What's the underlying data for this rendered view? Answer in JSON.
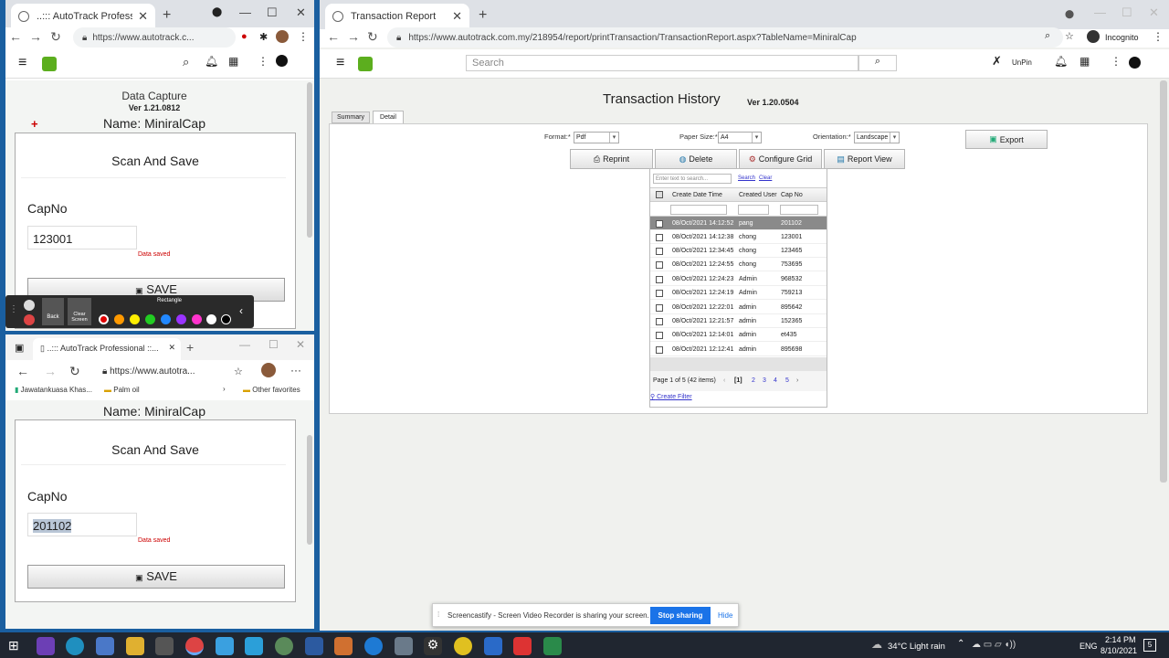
{
  "left_top_window": {
    "tab_title": "..::: AutoTrack Professional ::...",
    "url": "https://www.autotrack.c...",
    "app_title": "Data Capture",
    "version": "Ver 1.21.0812",
    "name_label": "Name: MiniralCap",
    "form_title": "Scan And Save",
    "field_label": "CapNo",
    "field_value": "123001",
    "status": "Data saved",
    "save_label": "SAVE"
  },
  "annotation_toolbar": {
    "back_label": "Back",
    "clear_label": "Clear Screen",
    "rect_label": "Rectangle",
    "colors": [
      "#e00000",
      "#ff9900",
      "#ffee00",
      "#22cc22",
      "#2288ff",
      "#9933ff",
      "#ff33cc",
      "#ffffff",
      "#000000"
    ]
  },
  "left_bottom_window": {
    "tab_title": "..::: AutoTrack Professional ::...",
    "url": "https://www.autotra...",
    "bookmark1": "Jawatankuasa Khas...",
    "bookmark2": "Palm oil",
    "bookmark3": "Other favorites",
    "name_label": "Name: MiniralCap",
    "form_title": "Scan And Save",
    "field_label": "CapNo",
    "field_value": "201102",
    "status": "Data saved",
    "save_label": "SAVE"
  },
  "main_window": {
    "tab_title": "Transaction Report",
    "url": "https://www.autotrack.com.my/218954/report/printTransaction/TransactionReport.aspx?TableName=MiniralCap",
    "incognito_label": "Incognito",
    "search_placeholder": "Search",
    "unpin_label": "UnPin",
    "page_title": "Transaction History",
    "version": "Ver 1.20.0504",
    "tabs": [
      "Summary",
      "Detail"
    ],
    "format_label": "Format:*",
    "format_value": "Pdf",
    "paper_label": "Paper Size:*",
    "paper_value": "A4",
    "orientation_label": "Orientation:*",
    "orientation_value": "Landscape",
    "export_label": "Export",
    "buttons": [
      "Reprint",
      "Delete",
      "Configure Grid",
      "Report View"
    ],
    "grid_search_placeholder": "Enter text to search...",
    "grid_search_link": "Search",
    "grid_clear_link": "Clear",
    "columns": [
      "Create Date Time",
      "Created User",
      "Cap No"
    ],
    "rows": [
      [
        "08/Oct/2021 14:12:52",
        "pang",
        "201102"
      ],
      [
        "08/Oct/2021 14:12:38",
        "chong",
        "123001"
      ],
      [
        "08/Oct/2021 12:34:45",
        "chong",
        "123465"
      ],
      [
        "08/Oct/2021 12:24:55",
        "chong",
        "753695"
      ],
      [
        "08/Oct/2021 12:24:23",
        "Admin",
        "968532"
      ],
      [
        "08/Oct/2021 12:24:19",
        "Admin",
        "759213"
      ],
      [
        "08/Oct/2021 12:22:01",
        "admin",
        "895642"
      ],
      [
        "08/Oct/2021 12:21:57",
        "admin",
        "152365"
      ],
      [
        "08/Oct/2021 12:14:01",
        "admin",
        "et435"
      ],
      [
        "08/Oct/2021 12:12:41",
        "admin",
        "895698"
      ]
    ],
    "pager_text": "Page 1 of 5 (42 items)",
    "pages": [
      "[1]",
      "2",
      "3",
      "4",
      "5"
    ],
    "create_filter": "Create Filter"
  },
  "screencastify": {
    "message": "Screencastify - Screen Video Recorder is sharing your screen.",
    "stop_label": "Stop sharing",
    "hide_label": "Hide"
  },
  "taskbar": {
    "weather": "34°C  Light rain",
    "lang": "ENG",
    "time": "2:14 PM",
    "date": "8/10/2021",
    "notif_count": "5"
  }
}
